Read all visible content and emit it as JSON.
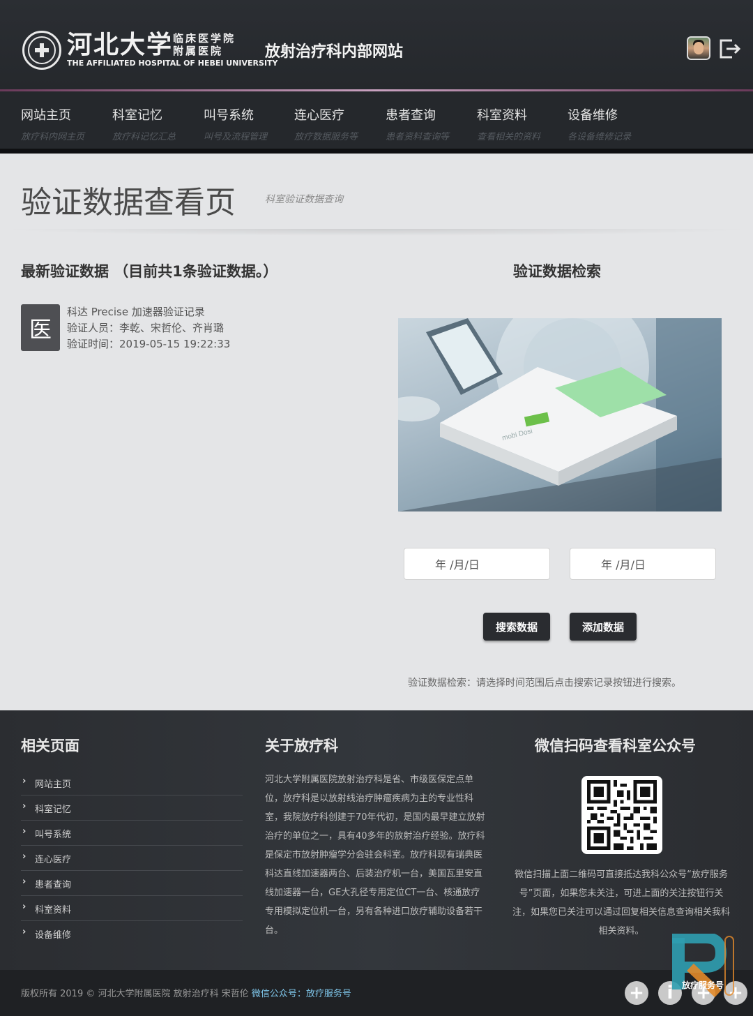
{
  "header": {
    "logo_name": "河北大学",
    "logo_sub": "临床医学院 附属医院",
    "logo_en": "THE AFFILIATED HOSPITAL OF HEBEI UNIVERSITY",
    "site_title": "放射治疗科内部网站",
    "avatar_icon": "user-avatar",
    "logout_icon": "logout-icon"
  },
  "nav": [
    {
      "label": "网站主页",
      "sub": "放疗科内网主页"
    },
    {
      "label": "科室记忆",
      "sub": "放疗科记忆汇总"
    },
    {
      "label": "叫号系统",
      "sub": "叫号及流程管理"
    },
    {
      "label": "连心医疗",
      "sub": "放疗数据服务等"
    },
    {
      "label": "患者查询",
      "sub": "患者资料查询等"
    },
    {
      "label": "科室资料",
      "sub": "查看相关的资料"
    },
    {
      "label": "设备维修",
      "sub": "各设备维修记录"
    }
  ],
  "page": {
    "title": "验证数据查看页",
    "subtitle": "科室验证数据查询"
  },
  "latest": {
    "heading": "最新验证数据 （目前共1条验证数据。）",
    "record": {
      "badge": "医",
      "title": "科达 Precise 加速器验证记录",
      "people": "验证人员：李乾、宋哲伦、齐肖璐",
      "time": "验证时间：2019-05-15 19:22:33"
    }
  },
  "search": {
    "heading": "验证数据检索",
    "start_placeholder": "年 /月/日",
    "end_placeholder": "年 /月/日",
    "search_button": "搜索数据",
    "add_button": "添加数据",
    "hint": "验证数据检索：请选择时间范围后点击搜索记录按钮进行搜索。",
    "device_text": "mobi Dosi"
  },
  "footer": {
    "links_heading": "相关页面",
    "links": [
      "网站主页",
      "科室记忆",
      "叫号系统",
      "连心医疗",
      "患者查询",
      "科室资料",
      "设备维修"
    ],
    "about_heading": "关于放疗科",
    "about_text": "河北大学附属医院放射治疗科是省、市级医保定点单位，放疗科是以放射线治疗肿瘤疾病为主的专业性科室，我院放疗科创建于70年代初，是国内最早建立放射治疗的单位之一，具有40多年的放射治疗经验。放疗科是保定市放射肿瘤学分会驻会科室。放疗科现有瑞典医科达直线加速器两台、后装治疗机一台，美国瓦里安直线加速器一台，GE大孔径专用定位CT一台、核通放疗专用模拟定位机一台，另有各种进口放疗辅助设备若干台。",
    "wechat_heading": "微信扫码查看科室公众号",
    "wechat_text": "微信扫描上面二维码可直接抵达我科公众号“放疗服务号”页面，如果您未关注，可进上面的关注按钮行关注，如果您已关注可以通过回复相关信息查询相关我科相关资料。"
  },
  "bottom": {
    "copyright": "版权所有 2019 © 河北大学附属医院 放射治疗科 宋哲伦",
    "wechat_label": "微信公众号：放疗服务号",
    "watermark_label": "放疗服务号"
  },
  "colors": {
    "header_bg": "#2b2e33",
    "accent_line": "#c9a2c0",
    "button_bg": "#2a2c30",
    "link_accent": "#7fc6ea"
  }
}
